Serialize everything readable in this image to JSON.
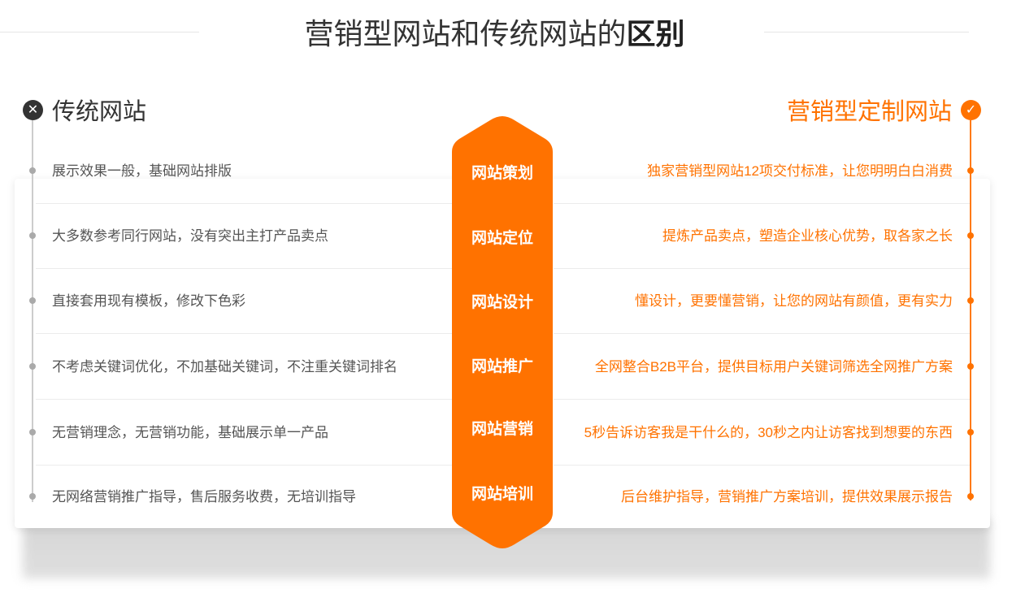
{
  "title": {
    "normal": "营销型网站和传统网站的",
    "bold": "区别"
  },
  "traditional": {
    "heading": "传统网站",
    "badge_icon": "close-icon"
  },
  "marketing": {
    "heading": "营销型定制网站",
    "badge_icon": "check-icon"
  },
  "colors": {
    "accent": "#ff7200",
    "dark": "#333333",
    "muted": "#555555"
  },
  "rows": [
    {
      "stage": "网站策划",
      "traditional": "展示效果一般，基础网站排版",
      "marketing": "独家营销型网站12项交付标准，让您明明白白消费"
    },
    {
      "stage": "网站定位",
      "traditional": "大多数参考同行网站，没有突出主打产品卖点",
      "marketing": "提炼产品卖点，塑造企业核心优势，取各家之长"
    },
    {
      "stage": "网站设计",
      "traditional": "直接套用现有模板，修改下色彩",
      "marketing": "懂设计，更要懂营销，让您的网站有颜值，更有实力"
    },
    {
      "stage": "网站推广",
      "traditional": "不考虑关键词优化，不加基础关键词，不注重关键词排名",
      "marketing": "全网整合B2B平台，提供目标用户关键词筛选全网推广方案"
    },
    {
      "stage": "网站营销",
      "traditional": "无营销理念，无营销功能，基础展示单一产品",
      "marketing": "5秒告诉访客我是干什么的，30秒之内让访客找到想要的东西"
    },
    {
      "stage": "网站培训",
      "traditional": "无网络营销推广指导，售后服务收费，无培训指导",
      "marketing": "后台维护指导，营销推广方案培训，提供效果展示报告"
    }
  ]
}
